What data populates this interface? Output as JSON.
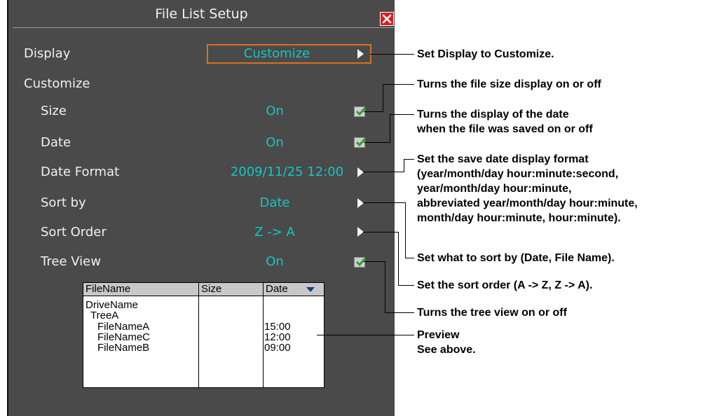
{
  "dialog": {
    "title": "File List Setup",
    "display_label": "Display",
    "display_value": "Customize",
    "customize_label": "Customize",
    "rows": {
      "size": {
        "label": "Size",
        "value": "On"
      },
      "date": {
        "label": "Date",
        "value": "On"
      },
      "date_format": {
        "label": "Date Format",
        "value": "2009/11/25 12:00"
      },
      "sort_by": {
        "label": "Sort by",
        "value": "Date"
      },
      "sort_order": {
        "label": "Sort Order",
        "value": "Z -> A"
      },
      "tree_view": {
        "label": "Tree View",
        "value": "On"
      }
    },
    "preview": {
      "headers": [
        "FileName",
        "Size",
        "Date"
      ],
      "names": [
        "DriveName",
        "TreeA",
        "FileNameA",
        "FileNameC",
        "FileNameB"
      ],
      "dates": [
        "15:00",
        "12:00",
        "09:00"
      ]
    }
  },
  "annotations": {
    "display": "Set Display to Customize.",
    "size": "Turns the file size display on or off",
    "date_line1": "Turns the display of the date",
    "date_line2": "when the file was saved on or off",
    "format_line1": "Set the save date display format",
    "format_line2": "(year/month/day hour:minute:second,",
    "format_line3": "year/month/day hour:minute,",
    "format_line4": "abbreviated year/month/day hour:minute,",
    "format_line5": "month/day hour:minute, hour:minute).",
    "sort_by": "Set what to sort by (Date, File Name).",
    "sort_order": "Set the sort order (A -> Z, Z -> A).",
    "tree_view": "Turns the tree view on or off",
    "preview_line1": "Preview",
    "preview_line2": "See above."
  },
  "colors": {
    "panel_bg": "#4a4a4a",
    "value_text": "#16c5c5",
    "focus_border": "#d4731f",
    "close_button": "#d42020",
    "check_mark": "#2f9a2f"
  }
}
